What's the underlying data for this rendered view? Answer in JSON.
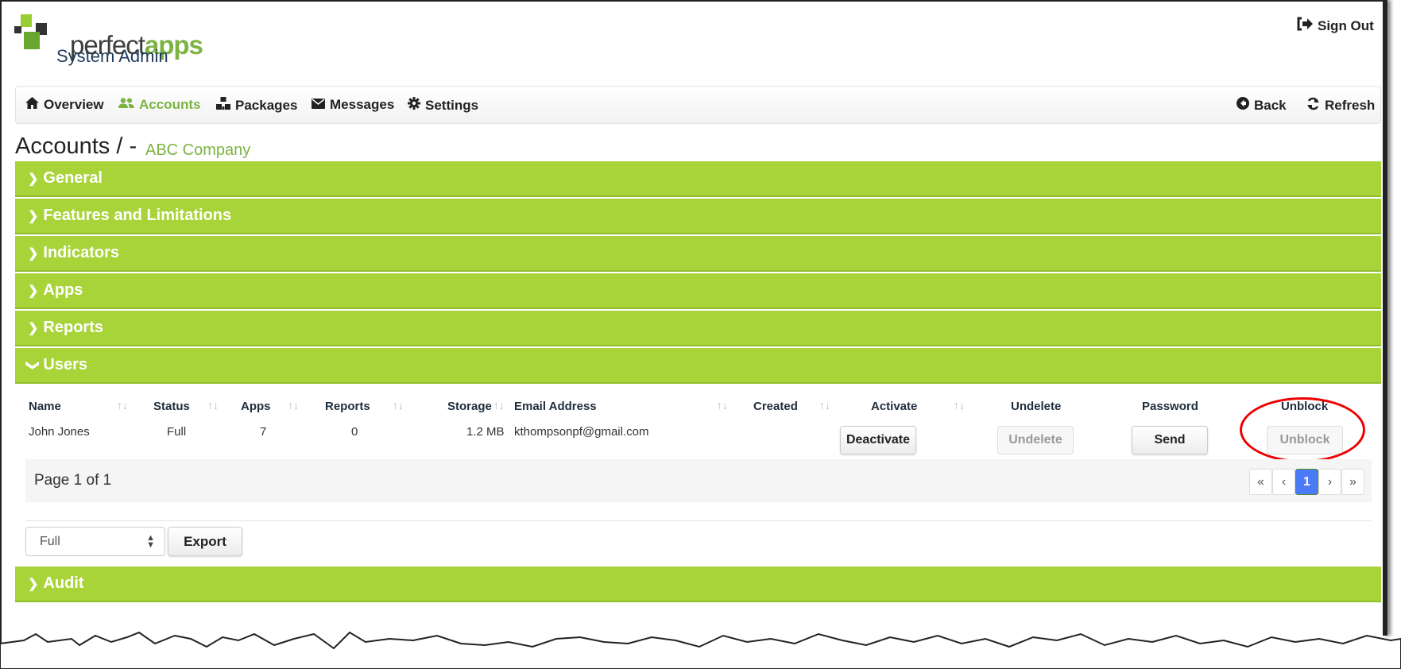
{
  "header": {
    "logo_text_1": "perfect",
    "logo_text_2": "apps",
    "subtitle": "System Admin",
    "signout_label": "Sign Out"
  },
  "nav": {
    "items": [
      {
        "label": "Overview",
        "icon": "home-icon",
        "active": false
      },
      {
        "label": "Accounts",
        "icon": "users-icon",
        "active": true
      },
      {
        "label": "Packages",
        "icon": "cubes-icon",
        "active": false
      },
      {
        "label": "Messages",
        "icon": "envelope-icon",
        "active": false
      },
      {
        "label": "Settings",
        "icon": "gear-icon",
        "active": false
      }
    ],
    "back_label": "Back",
    "refresh_label": "Refresh"
  },
  "page": {
    "title": "Accounts / -",
    "company": "ABC Company"
  },
  "sections": [
    {
      "label": "General",
      "expanded": false
    },
    {
      "label": "Features and Limitations",
      "expanded": false
    },
    {
      "label": "Indicators",
      "expanded": false
    },
    {
      "label": "Apps",
      "expanded": false
    },
    {
      "label": "Reports",
      "expanded": false
    },
    {
      "label": "Users",
      "expanded": true
    },
    {
      "label": "Audit",
      "expanded": false
    }
  ],
  "users_table": {
    "columns": [
      "Name",
      "Status",
      "Apps",
      "Reports",
      "Storage",
      "Email Address",
      "Created",
      "Activate",
      "Undelete",
      "Password",
      "Unblock"
    ],
    "rows": [
      {
        "name": "John Jones",
        "status": "Full",
        "apps": "7",
        "reports": "0",
        "storage": "1.2 MB",
        "email": "kthompsonpf@gmail.com",
        "created": "",
        "activate_btn": "Deactivate",
        "undelete_btn": "Undelete",
        "password_btn": "Send",
        "unblock_btn": "Unblock"
      }
    ]
  },
  "pagination": {
    "info": "Page 1 of 1",
    "first": "«",
    "prev": "‹",
    "current": "1",
    "next": "›",
    "last": "»"
  },
  "footer": {
    "filter_value": "Full",
    "export_label": "Export"
  },
  "colors": {
    "accent": "#7cb342",
    "section_bg": "#a8d43a",
    "active_page": "#4a7af5",
    "highlight": "#ee0000"
  }
}
